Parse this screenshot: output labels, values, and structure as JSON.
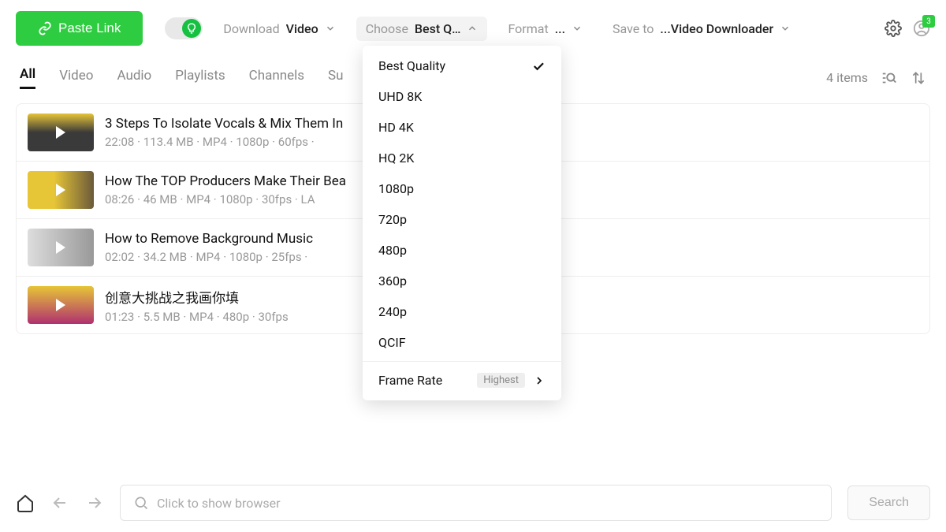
{
  "toolbar": {
    "paste_label": "Paste Link",
    "download_label": "Download",
    "download_value": "Video",
    "choose_label": "Choose",
    "choose_value": "Best Q…",
    "format_label": "Format",
    "format_value": "...",
    "save_label": "Save to",
    "save_value": "...Video Downloader",
    "badge_count": "3"
  },
  "tabs": {
    "items": [
      "All",
      "Video",
      "Audio",
      "Playlists",
      "Channels",
      "Su"
    ],
    "active_index": 0,
    "count_label": "4 items"
  },
  "quality_dropdown": {
    "options": [
      "Best Quality",
      "UHD 8K",
      "HD 4K",
      "HQ 2K",
      "1080p",
      "720p",
      "480p",
      "360p",
      "240p",
      "QCIF"
    ],
    "selected_index": 0,
    "frame_rate_label": "Frame Rate",
    "frame_rate_value": "Highest"
  },
  "videos": [
    {
      "title": "3 Steps To Isolate Vocals & Mix Them In",
      "meta": "22:08 · 113.4 MB · MP4 · 1080p · 60fps ·"
    },
    {
      "title": "How The TOP Producers Make Their Bea",
      "meta": "08:26 · 46 MB · MP4 · 1080p · 30fps · LA"
    },
    {
      "title": "How to Remove Background Music",
      "meta": "02:02 · 34.2 MB · MP4 · 1080p · 25fps ·"
    },
    {
      "title": "创意大挑战之我画你填",
      "meta": "01:23 · 5.5 MB · MP4 · 480p · 30fps"
    }
  ],
  "bottom": {
    "placeholder": "Click to show browser",
    "search_label": "Search"
  }
}
